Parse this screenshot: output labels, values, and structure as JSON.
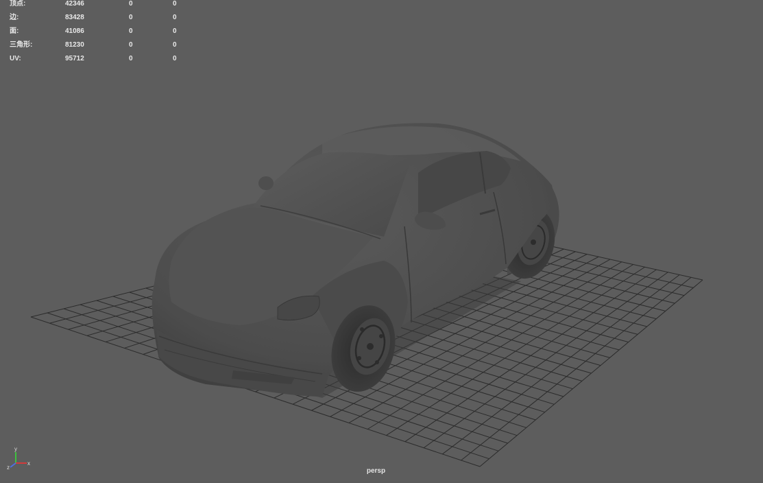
{
  "hud": {
    "rows": [
      {
        "label": "顶点:",
        "total": "42346",
        "selected": "0",
        "selected2": "0"
      },
      {
        "label": "边:",
        "total": "83428",
        "selected": "0",
        "selected2": "0"
      },
      {
        "label": "面:",
        "total": "41086",
        "selected": "0",
        "selected2": "0"
      },
      {
        "label": "三角形:",
        "total": "81230",
        "selected": "0",
        "selected2": "0"
      },
      {
        "label": "UV:",
        "total": "95712",
        "selected": "0",
        "selected2": "0"
      }
    ]
  },
  "viewport": {
    "camera_label": "persp",
    "background": "#5d5d5d",
    "grid_color": "#2b2b2b"
  },
  "axis_gizmo": {
    "x_label": "x",
    "y_label": "y",
    "z_label": "z",
    "x_color": "#d43a3a",
    "y_color": "#3fc23f",
    "z_color": "#4f6fe0"
  }
}
